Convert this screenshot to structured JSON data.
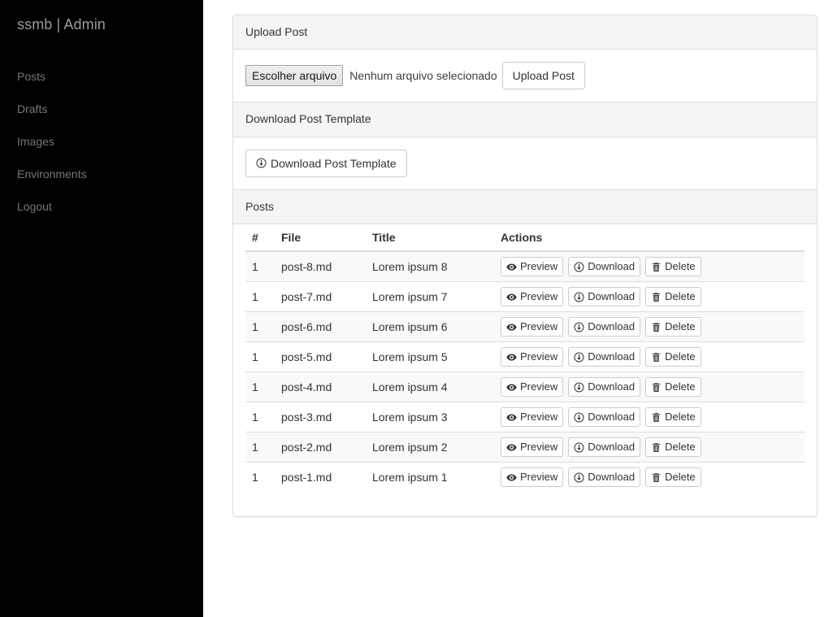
{
  "sidebar": {
    "brand": "ssmb | Admin",
    "items": [
      {
        "label": "Posts",
        "name": "posts"
      },
      {
        "label": "Drafts",
        "name": "drafts"
      },
      {
        "label": "Images",
        "name": "images"
      },
      {
        "label": "Environments",
        "name": "environments"
      },
      {
        "label": "Logout",
        "name": "logout"
      }
    ]
  },
  "upload_panel": {
    "heading": "Upload Post",
    "file_button_label": "Escolher arquivo",
    "file_status_text": "Nenhum arquivo selecionado",
    "submit_label": "Upload Post"
  },
  "template_panel": {
    "heading": "Download Post Template",
    "button_label": "Download Post Template",
    "button_icon": "download-circle-icon"
  },
  "posts_panel": {
    "heading": "Posts",
    "columns": [
      "#",
      "File",
      "Title",
      "Actions"
    ],
    "action_labels": {
      "preview": "Preview",
      "download": "Download",
      "delete": "Delete"
    },
    "action_icons": {
      "preview": "eye-icon",
      "download": "download-circle-icon",
      "delete": "trash-icon"
    },
    "rows": [
      {
        "num": "1",
        "file": "post-8.md",
        "title": "Lorem ipsum 8"
      },
      {
        "num": "1",
        "file": "post-7.md",
        "title": "Lorem ipsum 7"
      },
      {
        "num": "1",
        "file": "post-6.md",
        "title": "Lorem ipsum 6"
      },
      {
        "num": "1",
        "file": "post-5.md",
        "title": "Lorem ipsum 5"
      },
      {
        "num": "1",
        "file": "post-4.md",
        "title": "Lorem ipsum 4"
      },
      {
        "num": "1",
        "file": "post-3.md",
        "title": "Lorem ipsum 3"
      },
      {
        "num": "1",
        "file": "post-2.md",
        "title": "Lorem ipsum 2"
      },
      {
        "num": "1",
        "file": "post-1.md",
        "title": "Lorem ipsum 1"
      }
    ]
  },
  "colors": {
    "sidebar_bg": "#000000",
    "sidebar_link": "#777777",
    "sidebar_brand": "#999999",
    "panel_border": "#dddddd",
    "panel_heading_bg": "#f5f5f5",
    "row_stripe": "#f9f9f9",
    "text": "#333333"
  }
}
